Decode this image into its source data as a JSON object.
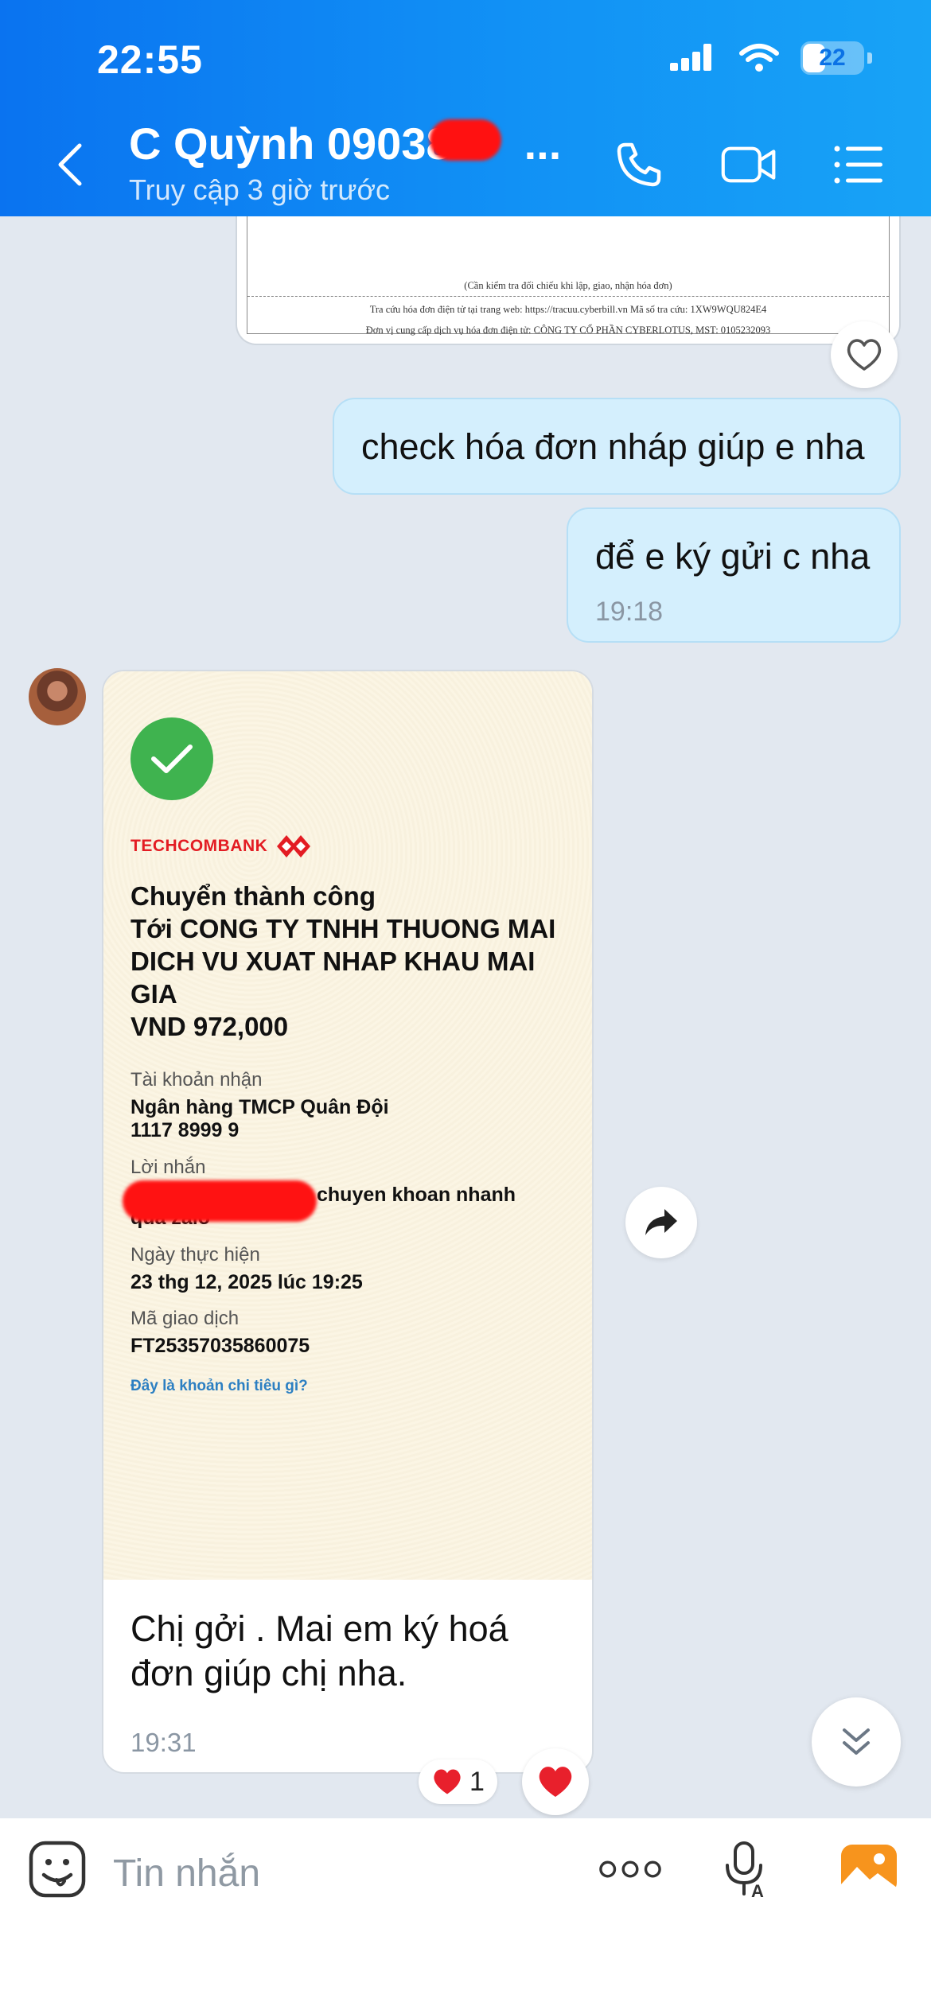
{
  "status_bar": {
    "time": "22:55",
    "battery": "22"
  },
  "header": {
    "contact_name": "C Quỳnh 09038",
    "contact_name_suffix": "...",
    "last_seen": "Truy cập 3 giờ trước"
  },
  "invoice_image": {
    "line1": "(Cần kiểm tra đối chiếu khi lập, giao, nhận hóa đơn)",
    "line2": "Tra cứu hóa đơn điện tử tại trang web: https://tracuu.cyberbill.vn Mã số tra cứu: 1XW9WQU824E4",
    "line3": "Đơn vị cung cấp dịch vụ hóa đơn điện tử: CÔNG TY CỔ PHẦN CYBERLOTUS, MST: 0105232093"
  },
  "messages": {
    "sent1": "check hóa đơn nháp giúp e nha",
    "sent2": "để e ký gửi c nha",
    "sent2_time": "19:18"
  },
  "receipt": {
    "bank": "TECHCOMBANK",
    "title_lines": [
      "Chuyển thành công",
      "Tới CONG TY TNHH THUONG MAI",
      "DICH VU XUAT NHAP KHAU MAI",
      "GIA",
      "VND 972,000"
    ],
    "account_label": "Tài khoản nhận",
    "account_bank": "Ngân hàng TMCP Quân Đội",
    "account_number": "1117 8999 9",
    "message_label": "Lời nhắn",
    "message_value": "chuyen khoan nhanh",
    "message_value2": "qua zalo",
    "date_label": "Ngày thực hiện",
    "date_value": "23 thg 12, 2025 lúc 19:25",
    "txn_label": "Mã giao dịch",
    "txn_value": "FT25357035860075",
    "link": "Đây là khoản chi tiêu gì?",
    "caption_line1": "Chị gởi . Mai em ký hoá",
    "caption_line2": "đơn giúp chị nha.",
    "time": "19:31"
  },
  "reaction": {
    "emoji": "❤️",
    "count": "1"
  },
  "input": {
    "placeholder": "Tin nhắn"
  },
  "colors": {
    "header": "#0a73f0",
    "sent_bubble": "#d4effd",
    "check": "#3fb34f",
    "techcombank_red": "#e31c23",
    "link": "#2c7fc2"
  }
}
